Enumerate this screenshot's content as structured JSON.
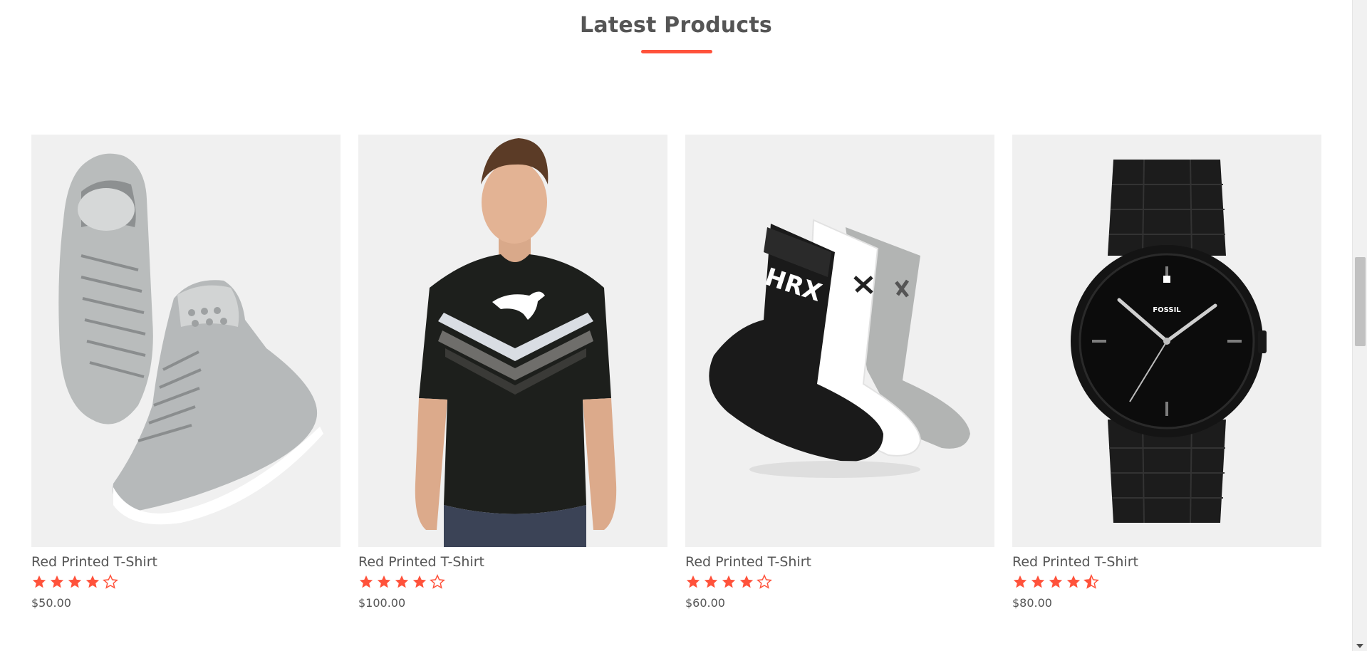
{
  "section": {
    "title": "Latest Products",
    "accent_color": "#ff523b"
  },
  "products": [
    {
      "name": "Red Printed T-Shirt",
      "price": "$50.00",
      "rating": 4,
      "image": "grey-high-top-sneakers"
    },
    {
      "name": "Red Printed T-Shirt",
      "price": "$100.00",
      "rating": 4,
      "image": "black-puma-tshirt-model"
    },
    {
      "name": "Red Printed T-Shirt",
      "price": "$60.00",
      "rating": 4,
      "image": "three-pairs-socks"
    },
    {
      "name": "Red Printed T-Shirt",
      "price": "$80.00",
      "rating": 4.5,
      "image": "black-fossil-watch",
      "watch_brand": "FOSSIL"
    }
  ],
  "icons": {
    "star_full": "star-icon",
    "star_half": "star-half-icon",
    "star_empty": "star-outline-icon"
  }
}
